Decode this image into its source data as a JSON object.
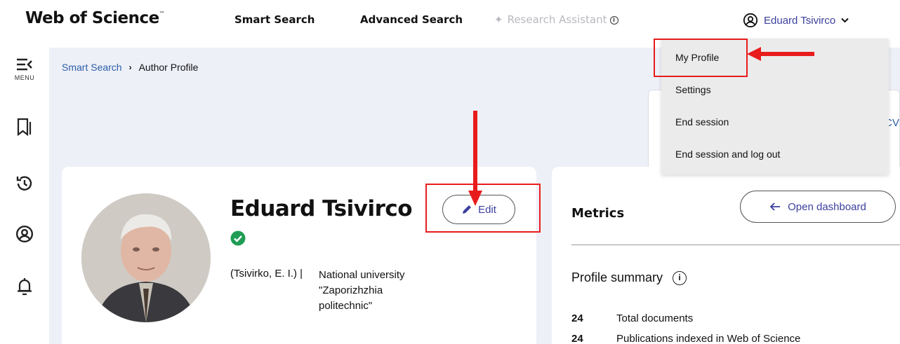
{
  "header": {
    "logo": "Web of Science",
    "logo_tm": "™",
    "nav": {
      "smart_search": "Smart Search",
      "advanced_search": "Advanced Search",
      "research_assistant": "Research Assistant",
      "research_assistant_info": "i"
    },
    "user_name": "Eduard Tsivirco"
  },
  "sidebar": {
    "menu_label": "MENU"
  },
  "breadcrumb": {
    "link": "Smart Search",
    "separator": "›",
    "current": "Author Profile"
  },
  "background_card": {
    "partial_text": "CV"
  },
  "profile": {
    "name": "Eduard Tsivirco",
    "also_known_as": "(Tsivirko, E. I.) |",
    "affiliation": "National university\n\"Zaporizhzhia\npolitechnic\"",
    "edit_label": "Edit"
  },
  "metrics": {
    "title": "Metrics",
    "open_dashboard_label": "Open dashboard",
    "profile_summary_title": "Profile summary",
    "stats": [
      {
        "value": "24",
        "label": "Total documents"
      },
      {
        "value": "24",
        "label": "Publications indexed in Web of Science"
      }
    ]
  },
  "user_dropdown": {
    "items": [
      {
        "label": "My Profile"
      },
      {
        "label": "Settings"
      },
      {
        "label": "End session"
      },
      {
        "label": "End session and log out"
      }
    ]
  },
  "colors": {
    "accent": "#3b3f9e",
    "link": "#2b5ea7",
    "annotation": "#e81c1c",
    "verified": "#1f9d55",
    "main_bg": "#eef0f8"
  }
}
